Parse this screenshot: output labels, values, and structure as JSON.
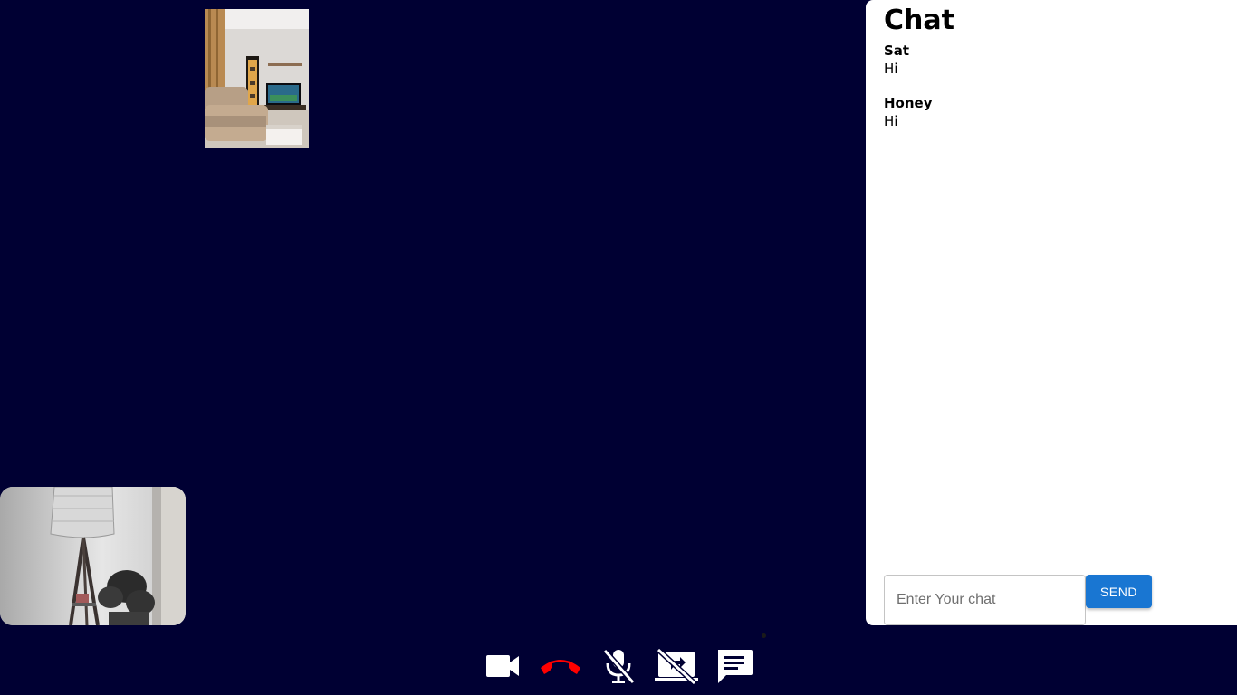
{
  "chat": {
    "title": "Chat",
    "messages": [
      {
        "sender": "Sat",
        "text": "Hi"
      },
      {
        "sender": "Honey",
        "text": "Hi"
      }
    ],
    "input": {
      "value": "",
      "placeholder": "Enter Your chat"
    },
    "send_label": "SEND"
  },
  "toolbar": {
    "buttons": [
      {
        "icon": "videocam-icon"
      },
      {
        "icon": "call-end-icon"
      },
      {
        "icon": "mic-off-icon"
      },
      {
        "icon": "screen-share-off-icon"
      },
      {
        "icon": "chat-icon"
      }
    ]
  },
  "colors": {
    "background": "#000033",
    "end_call": "#ff0000",
    "send_button": "#1976d2",
    "chat_panel": "#ffffff"
  }
}
